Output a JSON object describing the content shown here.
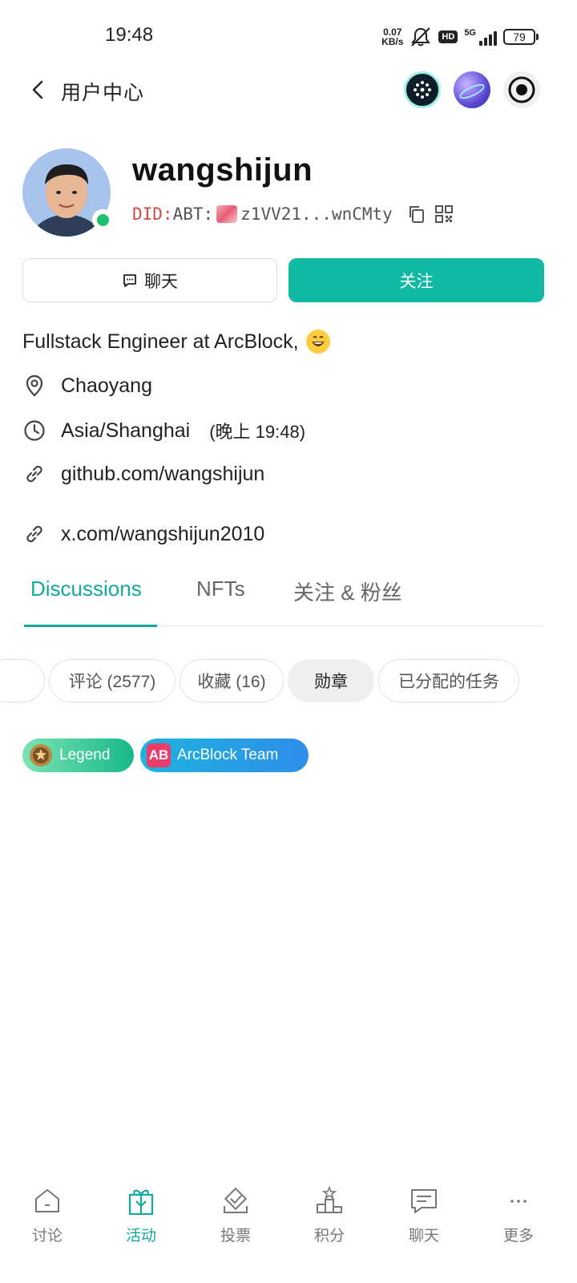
{
  "status_bar": {
    "time": "19:48",
    "net_speed_value": "0.07",
    "net_speed_unit": "KB/s",
    "hd": "HD",
    "network": "5G",
    "battery": "79"
  },
  "header": {
    "title": "用户中心"
  },
  "profile": {
    "username": "wangshijun",
    "did_prefix": "DID:",
    "did_chain": "ABT:",
    "did_address": "z1VV21...wnCMty",
    "chat_label": "聊天",
    "follow_label": "关注",
    "bio": "Fullstack Engineer at ArcBlock,",
    "location": "Chaoyang",
    "timezone": "Asia/Shanghai",
    "local_time": "(晚上 19:48)",
    "link_1": "github.com/wangshijun",
    "link_2": "x.com/wangshijun2010"
  },
  "tabs": [
    {
      "label": "Discussions"
    },
    {
      "label": "NFTs"
    },
    {
      "label": "关注 & 粉丝"
    }
  ],
  "chips": [
    {
      "label": "评论 (2577)"
    },
    {
      "label": "收藏 (16)"
    },
    {
      "label": "勋章"
    },
    {
      "label": "已分配的任务"
    }
  ],
  "badges": [
    {
      "label": "Legend",
      "icon": "legend-medal-icon",
      "color": "#17b88a"
    },
    {
      "label": "ArcBlock Team",
      "icon_text": "AB",
      "color": "#2d8ee8"
    }
  ],
  "bottom_nav": [
    {
      "label": "讨论",
      "icon": "home-icon"
    },
    {
      "label": "活动",
      "icon": "gift-icon"
    },
    {
      "label": "投票",
      "icon": "vote-icon"
    },
    {
      "label": "积分",
      "icon": "podium-icon"
    },
    {
      "label": "聊天",
      "icon": "chat-bubble-icon"
    },
    {
      "label": "更多",
      "icon": "more-dots-icon"
    }
  ],
  "colors": {
    "accent": "#13a99c",
    "follow_button": "#11b8a4",
    "online": "#1fc16b",
    "did_prefix": "#d14a4a"
  }
}
